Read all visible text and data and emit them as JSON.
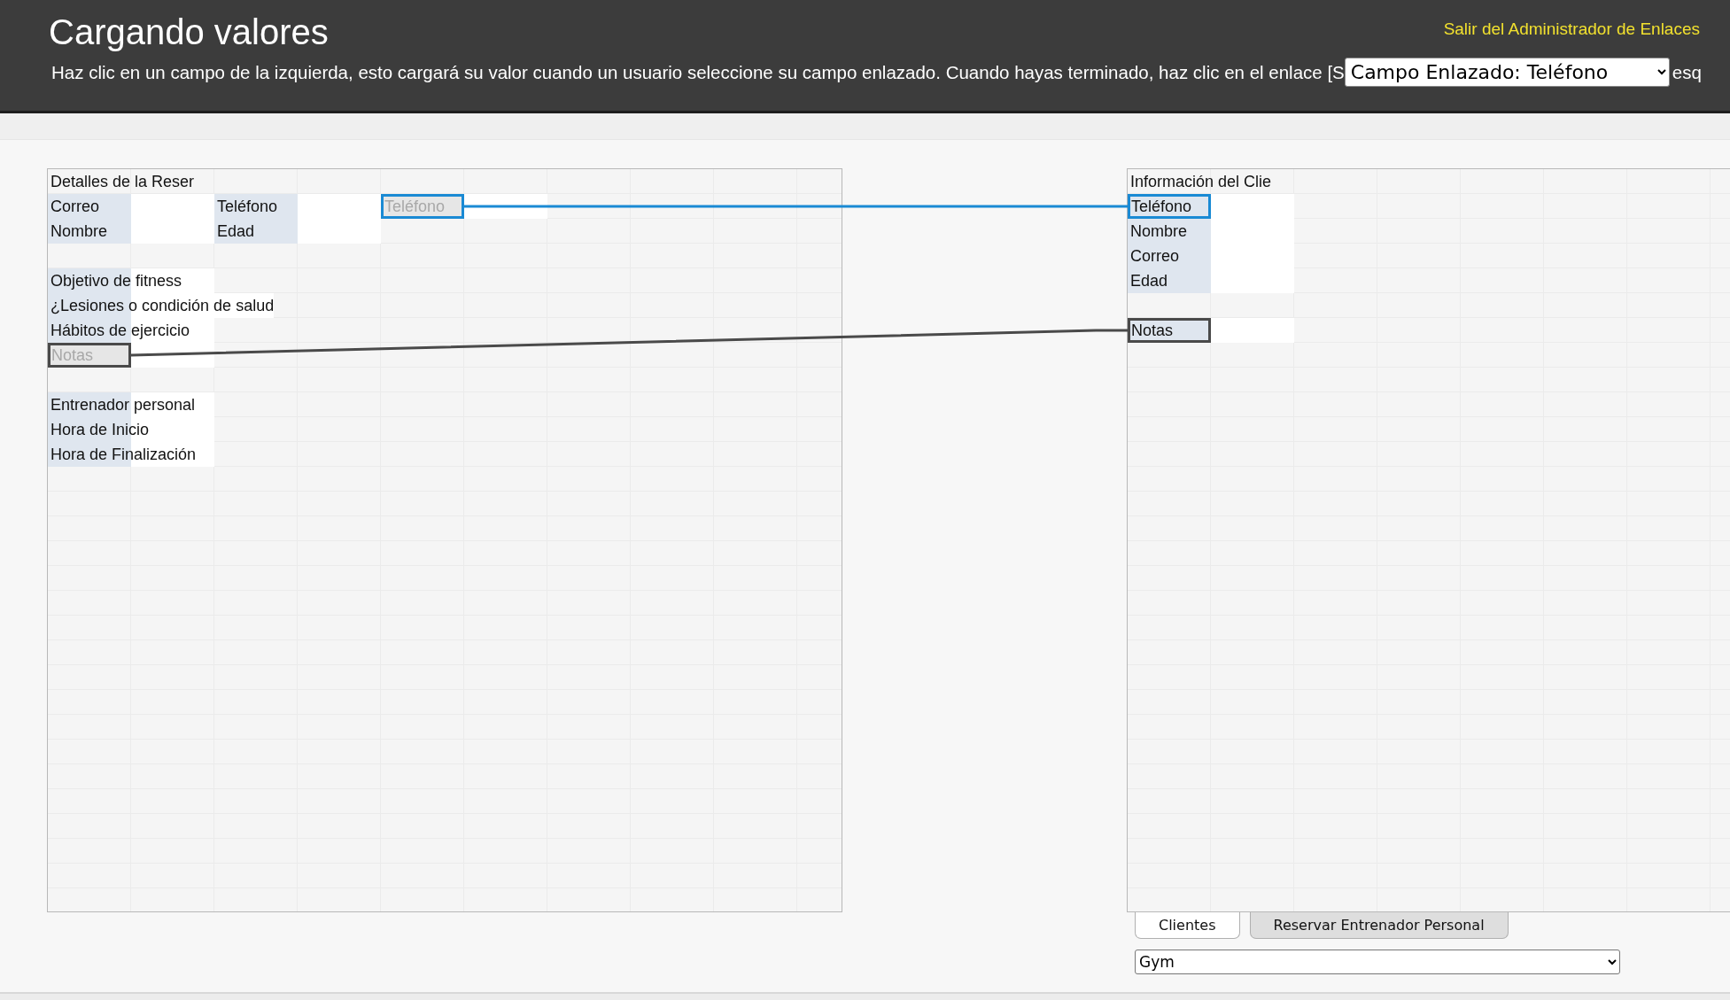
{
  "header": {
    "title": "Cargando valores",
    "exit_link": "Salir del Administrador de Enlaces",
    "description": "Haz clic en un campo de la izquierda, esto cargará su valor cuando un usuario seleccione su campo enlazado. Cuando hayas terminado, haz clic en el enlace [S",
    "linked_field_select": "Campo Enlazado: Teléfono",
    "description_tail": "esq"
  },
  "left_panel": {
    "title": "Detalles de la Reser",
    "rows": [
      {
        "kind": "fields",
        "cells": [
          {
            "kind": "label",
            "text": "Correo"
          },
          {
            "kind": "input"
          },
          {
            "kind": "label",
            "text": "Teléfono"
          },
          {
            "kind": "input"
          },
          {
            "kind": "linked-source",
            "text": "Teléfono",
            "color": "#1a8ad4"
          },
          {
            "kind": "input"
          }
        ]
      },
      {
        "kind": "fields",
        "cells": [
          {
            "kind": "label",
            "text": "Nombre"
          },
          {
            "kind": "input"
          },
          {
            "kind": "label",
            "text": "Edad"
          },
          {
            "kind": "input"
          }
        ]
      },
      {
        "kind": "gap"
      },
      {
        "kind": "fields",
        "cells": [
          {
            "kind": "long-label",
            "text": "Objetivo de fitness"
          }
        ]
      },
      {
        "kind": "fields",
        "cells": [
          {
            "kind": "long-label",
            "text": "¿Lesiones o condición de salud"
          }
        ]
      },
      {
        "kind": "fields",
        "cells": [
          {
            "kind": "long-label",
            "text": "Hábitos de ejercicio"
          }
        ]
      },
      {
        "kind": "fields",
        "cells": [
          {
            "kind": "linked-source",
            "text": "Notas",
            "color": "#4a4a4a"
          },
          {
            "kind": "input"
          }
        ]
      },
      {
        "kind": "gap"
      },
      {
        "kind": "fields",
        "cells": [
          {
            "kind": "long-label",
            "text": "Entrenador personal"
          }
        ]
      },
      {
        "kind": "fields",
        "cells": [
          {
            "kind": "long-label",
            "text": "Hora de Inicio"
          }
        ]
      },
      {
        "kind": "fields",
        "cells": [
          {
            "kind": "long-label",
            "text": "Hora de Finalización"
          }
        ]
      }
    ]
  },
  "right_panel": {
    "title": "Información del Clie",
    "rows": [
      {
        "kind": "fields",
        "cells": [
          {
            "kind": "linked-target",
            "text": "Teléfono",
            "color": "#1a8ad4"
          },
          {
            "kind": "input"
          }
        ]
      },
      {
        "kind": "fields",
        "cells": [
          {
            "kind": "label",
            "text": "Nombre"
          },
          {
            "kind": "input"
          }
        ]
      },
      {
        "kind": "fields",
        "cells": [
          {
            "kind": "label",
            "text": "Correo"
          },
          {
            "kind": "input"
          }
        ]
      },
      {
        "kind": "fields",
        "cells": [
          {
            "kind": "label",
            "text": "Edad"
          },
          {
            "kind": "input"
          }
        ]
      },
      {
        "kind": "gap"
      },
      {
        "kind": "fields",
        "cells": [
          {
            "kind": "linked-target",
            "text": "Notas",
            "color": "#4a4a4a"
          },
          {
            "kind": "input"
          }
        ]
      }
    ]
  },
  "tabs": [
    {
      "label": "Clientes",
      "selected": true
    },
    {
      "label": "Reservar Entrenador Personal",
      "selected": false
    }
  ],
  "database_select": "Gym"
}
